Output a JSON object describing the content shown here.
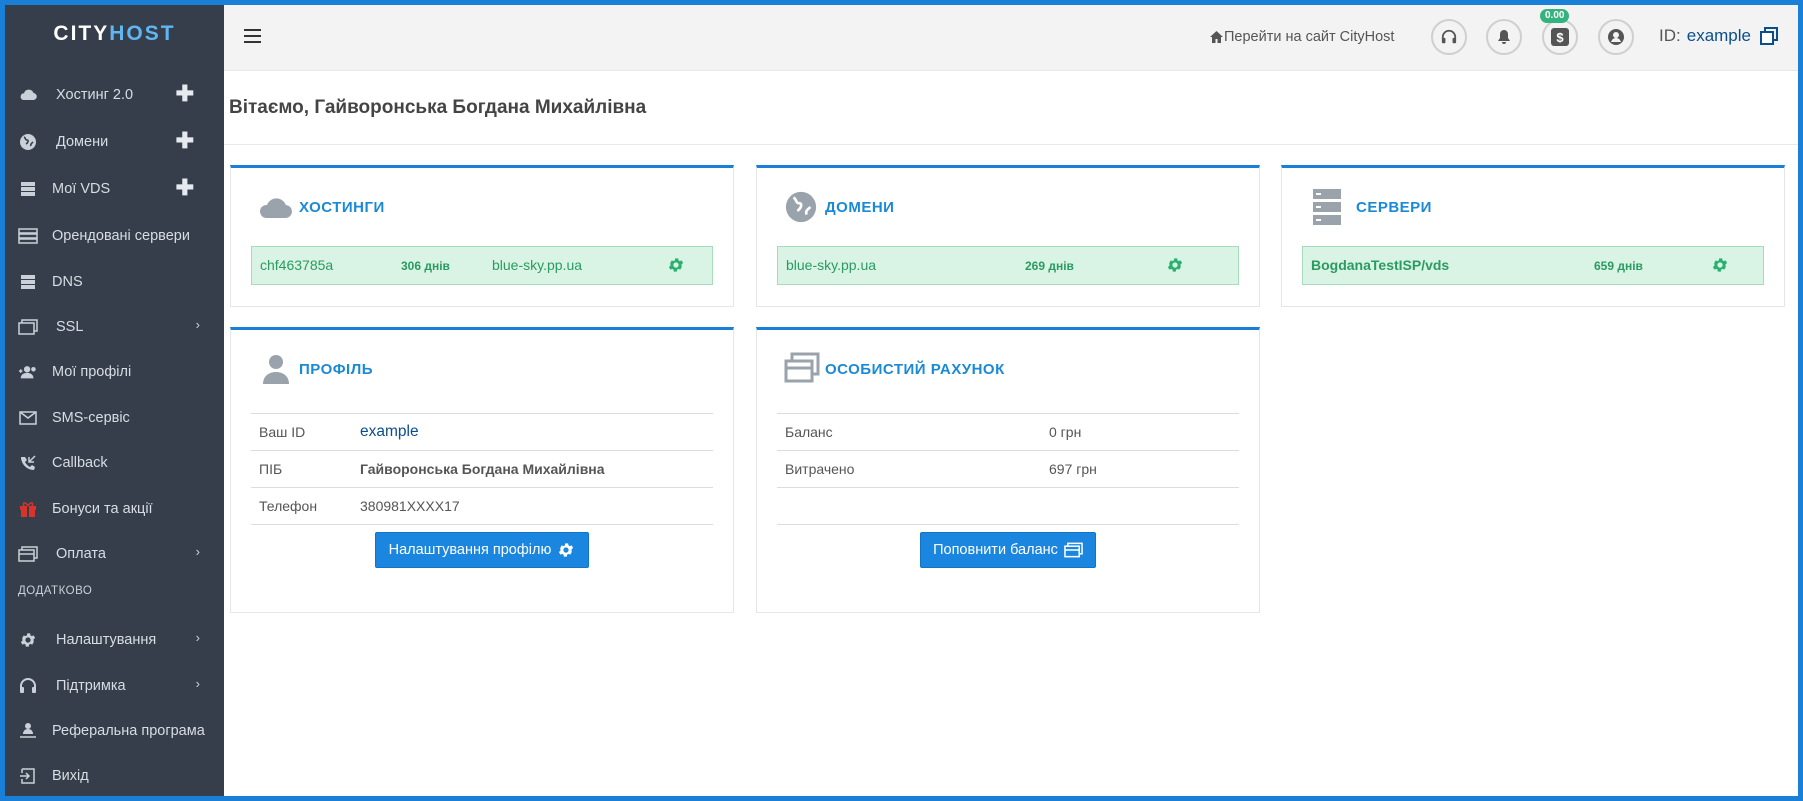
{
  "logo": {
    "part1": "CITY",
    "part2": "HOST"
  },
  "sidebar": {
    "items": [
      {
        "label": "Хостинг 2.0",
        "icon": "cloud-icon"
      },
      {
        "label": "Домени",
        "icon": "globe-icon"
      },
      {
        "label": "Мої VDS",
        "icon": "server-icon"
      },
      {
        "label": "Орендовані сервери",
        "icon": "servers-icon"
      },
      {
        "label": "DNS",
        "icon": "dns-icon"
      },
      {
        "label": "SSL",
        "icon": "ssl-icon"
      },
      {
        "label": "Мої профілі",
        "icon": "profiles-icon"
      },
      {
        "label": "SMS-сервіс",
        "icon": "mail-icon"
      },
      {
        "label": "Callback",
        "icon": "callback-icon"
      },
      {
        "label": "Бонуси та акції",
        "icon": "gift-icon"
      },
      {
        "label": "Оплата",
        "icon": "payment-icon"
      }
    ],
    "section_label": "ДОДАТКОВО",
    "extra_items": [
      {
        "label": "Налаштування",
        "icon": "gear-icon"
      },
      {
        "label": "Підтримка",
        "icon": "headset-icon"
      },
      {
        "label": "Реферальна програма",
        "icon": "referral-icon"
      },
      {
        "label": "Вихід",
        "icon": "logout-icon"
      }
    ],
    "plus": "✚",
    "chevron": "›"
  },
  "topbar": {
    "goto_site": "Перейти на сайт CityHost",
    "balance_badge": "0.00",
    "id_label": "ID:",
    "id_value": "example"
  },
  "greeting": "Вітаємо, Гайворонська Богдана Михайлівна",
  "hosting": {
    "title": "ХОСТИНГИ",
    "name": "chf463785a",
    "days": "306 днів",
    "domain": "blue-sky.pp.ua"
  },
  "domains": {
    "title": "ДОМЕНИ",
    "name": "blue-sky.pp.ua",
    "days": "269 днів"
  },
  "servers": {
    "title": "СЕРВЕРИ",
    "name": "BogdanaTestISP/vds",
    "days": "659 днів"
  },
  "profile": {
    "title": "ПРОФІЛЬ",
    "rows": [
      {
        "label": "Ваш ID",
        "value": "example"
      },
      {
        "label": "ПІБ",
        "value": "Гайворонська Богдана Михайлівна"
      },
      {
        "label": "Телефон",
        "value": "380981XXXX17"
      }
    ],
    "button": "Налаштування профілю"
  },
  "account": {
    "title": "ОСОБИСТИЙ РАХУНОК",
    "rows": [
      {
        "label": "Баланс",
        "value": "0 грн"
      },
      {
        "label": "Витрачено",
        "value": "697 грн"
      }
    ],
    "button": "Поповнити баланс"
  },
  "colors": {
    "accent": "#1a7fd6",
    "sidebar": "#353e4a",
    "green": "#2b9b62"
  }
}
